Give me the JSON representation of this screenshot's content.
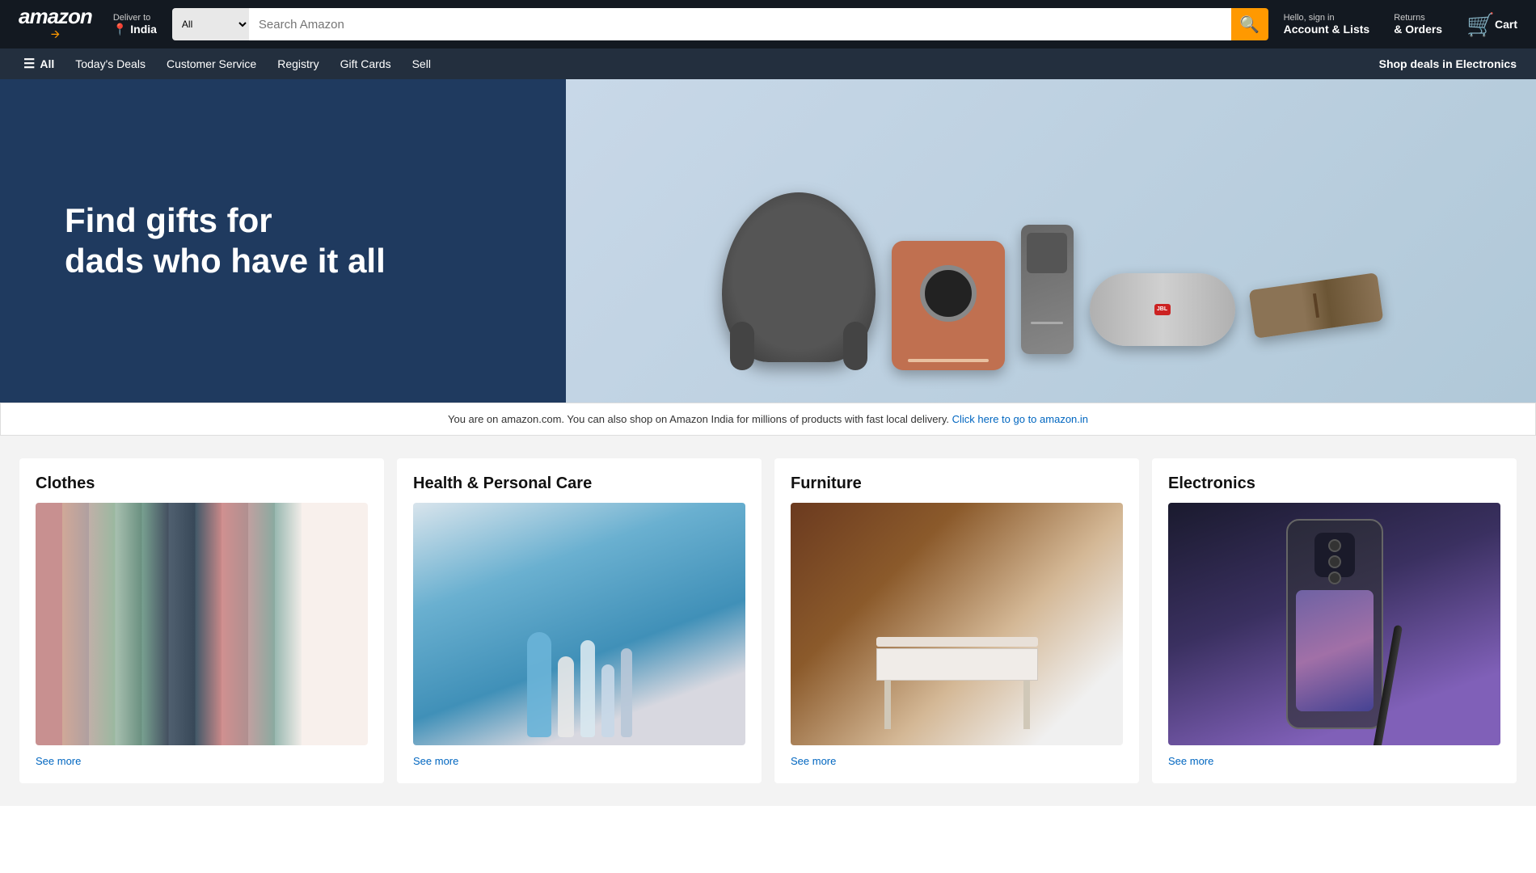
{
  "header": {
    "logo": "amazon",
    "logo_tagline": "↗",
    "deliver_to_label": "Deliver to",
    "deliver_to_country": "India",
    "search_category": "All",
    "search_placeholder": "Search Amazon",
    "account_greeting": "Hello, sign in",
    "account_label": "Account & Lists",
    "returns_label": "Returns",
    "orders_label": "& Orders",
    "cart_label": "Cart"
  },
  "navbar": {
    "all_label": "All",
    "links": [
      {
        "label": "Today's Deals"
      },
      {
        "label": "Customer Service"
      },
      {
        "label": "Registry"
      },
      {
        "label": "Gift Cards"
      },
      {
        "label": "Sell"
      }
    ],
    "promo_label": "Shop deals in Electronics"
  },
  "hero": {
    "title_line1": "Find gifts for",
    "title_line2": "dads who have it all"
  },
  "india_notice": {
    "text": "You are on amazon.com. You can also shop on Amazon India for millions of products with fast local delivery.",
    "link_text": "Click here to go to amazon.in"
  },
  "categories": [
    {
      "title": "Clothes",
      "see_more": "See more"
    },
    {
      "title": "Health & Personal Care",
      "see_more": "See more"
    },
    {
      "title": "Furniture",
      "see_more": "See more"
    },
    {
      "title": "Electronics",
      "see_more": "See more"
    }
  ]
}
